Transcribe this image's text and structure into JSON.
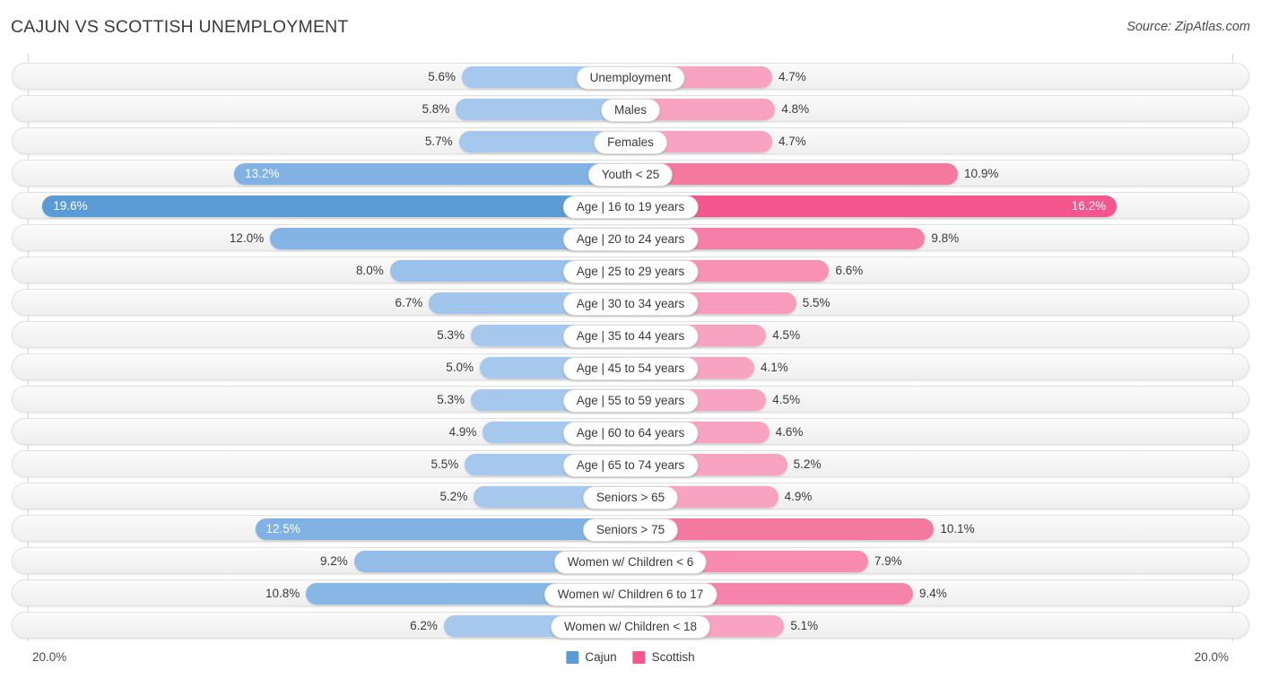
{
  "header": {
    "title": "CAJUN VS SCOTTISH UNEMPLOYMENT",
    "source": "Source: ZipAtlas.com"
  },
  "footer": {
    "axis_left": "20.0%",
    "axis_right": "20.0%"
  },
  "legend": {
    "items": [
      {
        "label": "Cajun",
        "color": "#5b9bd5"
      },
      {
        "label": "Scottish",
        "color": "#f4568d"
      }
    ]
  },
  "colors": {
    "cajun_light": "#a6c8ec",
    "cajun_mid": "#89b6e5",
    "cajun_strong": "#5b9bd5",
    "scottish_light": "#f9a3c3",
    "scottish_mid": "#f57fa8",
    "scottish_strong": "#f4568d",
    "track": "#f4f4f4",
    "gridline": "#d8d8d8"
  },
  "chart_data": {
    "type": "bar",
    "title": "CAJUN VS SCOTTISH UNEMPLOYMENT",
    "subtitle": "Source: ZipAtlas.com",
    "orientation": "horizontal-diverging",
    "xlabel": "",
    "ylabel": "",
    "axis_max": 20.0,
    "axis_min": 0.0,
    "unit": "%",
    "grid": true,
    "legend_position": "bottom-center",
    "categories": [
      "Unemployment",
      "Males",
      "Females",
      "Youth < 25",
      "Age | 16 to 19 years",
      "Age | 20 to 24 years",
      "Age | 25 to 29 years",
      "Age | 30 to 34 years",
      "Age | 35 to 44 years",
      "Age | 45 to 54 years",
      "Age | 55 to 59 years",
      "Age | 60 to 64 years",
      "Age | 65 to 74 years",
      "Seniors > 65",
      "Seniors > 75",
      "Women w/ Children < 6",
      "Women w/ Children 6 to 17",
      "Women w/ Children < 18"
    ],
    "series": [
      {
        "name": "Cajun",
        "color": "#5b9bd5",
        "side": "left",
        "values": [
          5.6,
          5.8,
          5.7,
          13.2,
          19.6,
          12.0,
          8.0,
          6.7,
          5.3,
          5.0,
          5.3,
          4.9,
          5.5,
          5.2,
          12.5,
          9.2,
          10.8,
          6.2
        ]
      },
      {
        "name": "Scottish",
        "color": "#f4568d",
        "side": "right",
        "values": [
          4.7,
          4.8,
          4.7,
          10.9,
          16.2,
          9.8,
          6.6,
          5.5,
          4.5,
          4.1,
          4.5,
          4.6,
          5.2,
          4.9,
          10.1,
          7.9,
          9.4,
          5.1
        ]
      }
    ]
  },
  "rows": [
    {
      "label": "Unemployment",
      "left_value": "5.6%",
      "right_value": "4.7%",
      "left_num": 5.6,
      "right_num": 4.7,
      "left_inside": false,
      "right_inside": false,
      "left_color": "#a6c8ec",
      "right_color": "#f9a3c3"
    },
    {
      "label": "Males",
      "left_value": "5.8%",
      "right_value": "4.8%",
      "left_num": 5.8,
      "right_num": 4.8,
      "left_inside": false,
      "right_inside": false,
      "left_color": "#a6c8ec",
      "right_color": "#f9a3c3"
    },
    {
      "label": "Females",
      "left_value": "5.7%",
      "right_value": "4.7%",
      "left_num": 5.7,
      "right_num": 4.7,
      "left_inside": false,
      "right_inside": false,
      "left_color": "#a6c8ec",
      "right_color": "#f9a3c3"
    },
    {
      "label": "Youth < 25",
      "left_value": "13.2%",
      "right_value": "10.9%",
      "left_num": 13.2,
      "right_num": 10.9,
      "left_inside": true,
      "right_inside": false,
      "left_color": "#81b2e3",
      "right_color": "#f4799f"
    },
    {
      "label": "Age | 16 to 19 years",
      "left_value": "19.6%",
      "right_value": "16.2%",
      "left_num": 19.6,
      "right_num": 16.2,
      "left_inside": true,
      "right_inside": true,
      "left_color": "#5b9bd5",
      "right_color": "#f4568d"
    },
    {
      "label": "Age | 20 to 24 years",
      "left_value": "12.0%",
      "right_value": "9.8%",
      "left_num": 12.0,
      "right_num": 9.8,
      "left_inside": false,
      "right_inside": false,
      "left_color": "#83b4e4",
      "right_color": "#f57fa8"
    },
    {
      "label": "Age | 25 to 29 years",
      "left_value": "8.0%",
      "right_value": "6.6%",
      "left_num": 8.0,
      "right_num": 6.6,
      "left_inside": false,
      "right_inside": false,
      "left_color": "#9ac1e9",
      "right_color": "#f792b5"
    },
    {
      "label": "Age | 30 to 34 years",
      "left_value": "6.7%",
      "right_value": "5.5%",
      "left_num": 6.7,
      "right_num": 5.5,
      "left_inside": false,
      "right_inside": false,
      "left_color": "#a2c5eb",
      "right_color": "#f89bbc"
    },
    {
      "label": "Age | 35 to 44 years",
      "left_value": "5.3%",
      "right_value": "4.5%",
      "left_num": 5.3,
      "right_num": 4.5,
      "left_inside": false,
      "right_inside": false,
      "left_color": "#a6c8ec",
      "right_color": "#f9a3c3"
    },
    {
      "label": "Age | 45 to 54 years",
      "left_value": "5.0%",
      "right_value": "4.1%",
      "left_num": 5.0,
      "right_num": 4.1,
      "left_inside": false,
      "right_inside": false,
      "left_color": "#a6c8ec",
      "right_color": "#f9a3c3"
    },
    {
      "label": "Age | 55 to 59 years",
      "left_value": "5.3%",
      "right_value": "4.5%",
      "left_num": 5.3,
      "right_num": 4.5,
      "left_inside": false,
      "right_inside": false,
      "left_color": "#a6c8ec",
      "right_color": "#f9a3c3"
    },
    {
      "label": "Age | 60 to 64 years",
      "left_value": "4.9%",
      "right_value": "4.6%",
      "left_num": 4.9,
      "right_num": 4.6,
      "left_inside": false,
      "right_inside": false,
      "left_color": "#a6c8ec",
      "right_color": "#f9a3c3"
    },
    {
      "label": "Age | 65 to 74 years",
      "left_value": "5.5%",
      "right_value": "5.2%",
      "left_num": 5.5,
      "right_num": 5.2,
      "left_inside": false,
      "right_inside": false,
      "left_color": "#a6c8ec",
      "right_color": "#f9a3c3"
    },
    {
      "label": "Seniors > 65",
      "left_value": "5.2%",
      "right_value": "4.9%",
      "left_num": 5.2,
      "right_num": 4.9,
      "left_inside": false,
      "right_inside": false,
      "left_color": "#a6c8ec",
      "right_color": "#f9a3c3"
    },
    {
      "label": "Seniors > 75",
      "left_value": "12.5%",
      "right_value": "10.1%",
      "left_num": 12.5,
      "right_num": 10.1,
      "left_inside": true,
      "right_inside": false,
      "left_color": "#81b2e3",
      "right_color": "#f4799f"
    },
    {
      "label": "Women w/ Children < 6",
      "left_value": "9.2%",
      "right_value": "7.9%",
      "left_num": 9.2,
      "right_num": 7.9,
      "left_inside": false,
      "right_inside": false,
      "left_color": "#93bde7",
      "right_color": "#f78cb0"
    },
    {
      "label": "Women w/ Children 6 to 17",
      "left_value": "10.8%",
      "right_value": "9.4%",
      "left_num": 10.8,
      "right_num": 9.4,
      "left_inside": false,
      "right_inside": false,
      "left_color": "#89b7e5",
      "right_color": "#f683ab"
    },
    {
      "label": "Women w/ Children < 18",
      "left_value": "6.2%",
      "right_value": "5.1%",
      "left_num": 6.2,
      "right_num": 5.1,
      "left_inside": false,
      "right_inside": false,
      "left_color": "#a6c8ec",
      "right_color": "#f9a3c3"
    }
  ]
}
